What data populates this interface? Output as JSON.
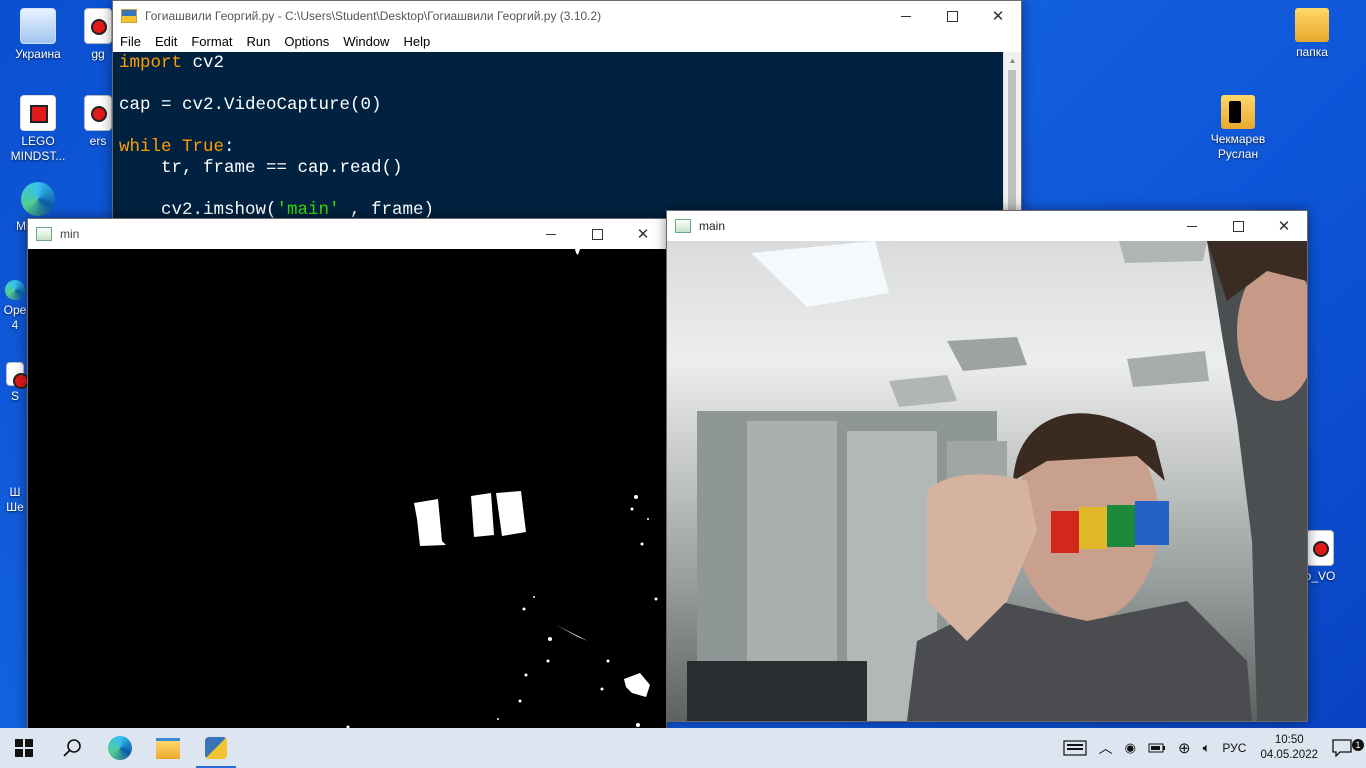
{
  "desktop": {
    "icons_left": [
      {
        "label": "Украина",
        "icon": "recycle-bin-icon"
      },
      {
        "label": "LEGO MINDST...",
        "icon": "lego-mindstorms-icon"
      },
      {
        "label": "Mi... E...",
        "icon": "edge-icon"
      }
    ],
    "icons_left_partial": [
      {
        "label": "gg",
        "icon": "file-icon"
      },
      {
        "label": "ers",
        "icon": "file-icon"
      },
      {
        "label": "Ope 4",
        "icon": "app-icon"
      },
      {
        "label": "S",
        "icon": "app-icon"
      },
      {
        "label": "Ш Ше",
        "icon": "app-icon"
      }
    ],
    "icons_right": [
      {
        "label": "папка",
        "icon": "folder-icon"
      },
      {
        "label": "Чекмарев Руслан",
        "icon": "folder-icon"
      },
      {
        "label": "o_VO",
        "icon": "lego-file-icon"
      }
    ]
  },
  "idle": {
    "title": "Гогиашвили Георгий.py - C:\\Users\\Student\\Desktop\\Гогиашвили Георгий.py (3.10.2)",
    "menu": [
      "File",
      "Edit",
      "Format",
      "Run",
      "Options",
      "Window",
      "Help"
    ],
    "code": {
      "l1_kw": "import",
      "l1_rest": " cv2",
      "l3": "cap = cv2.VideoCapture(0)",
      "l5_kw": "while",
      "l5_kw2": "True",
      "l5_rest": ":",
      "l6": "    tr, frame == cap.read()",
      "l8_pre": "    cv2.imshow(",
      "l8_str": "'main'",
      "l8_post": " , frame)"
    }
  },
  "min_window": {
    "title": "min"
  },
  "main_window": {
    "title": "main"
  },
  "taskbar": {
    "language": "РУС",
    "time": "10:50",
    "date": "04.05.2022",
    "notification_count": "1",
    "apps": [
      "start-icon",
      "search-icon",
      "edge-icon",
      "file-explorer-icon",
      "python-idle-icon"
    ]
  },
  "colors": {
    "idle_bg": "#002240",
    "keyword": "#ff9d00",
    "string": "#3ad900",
    "taskbar": "#dde6f0"
  }
}
